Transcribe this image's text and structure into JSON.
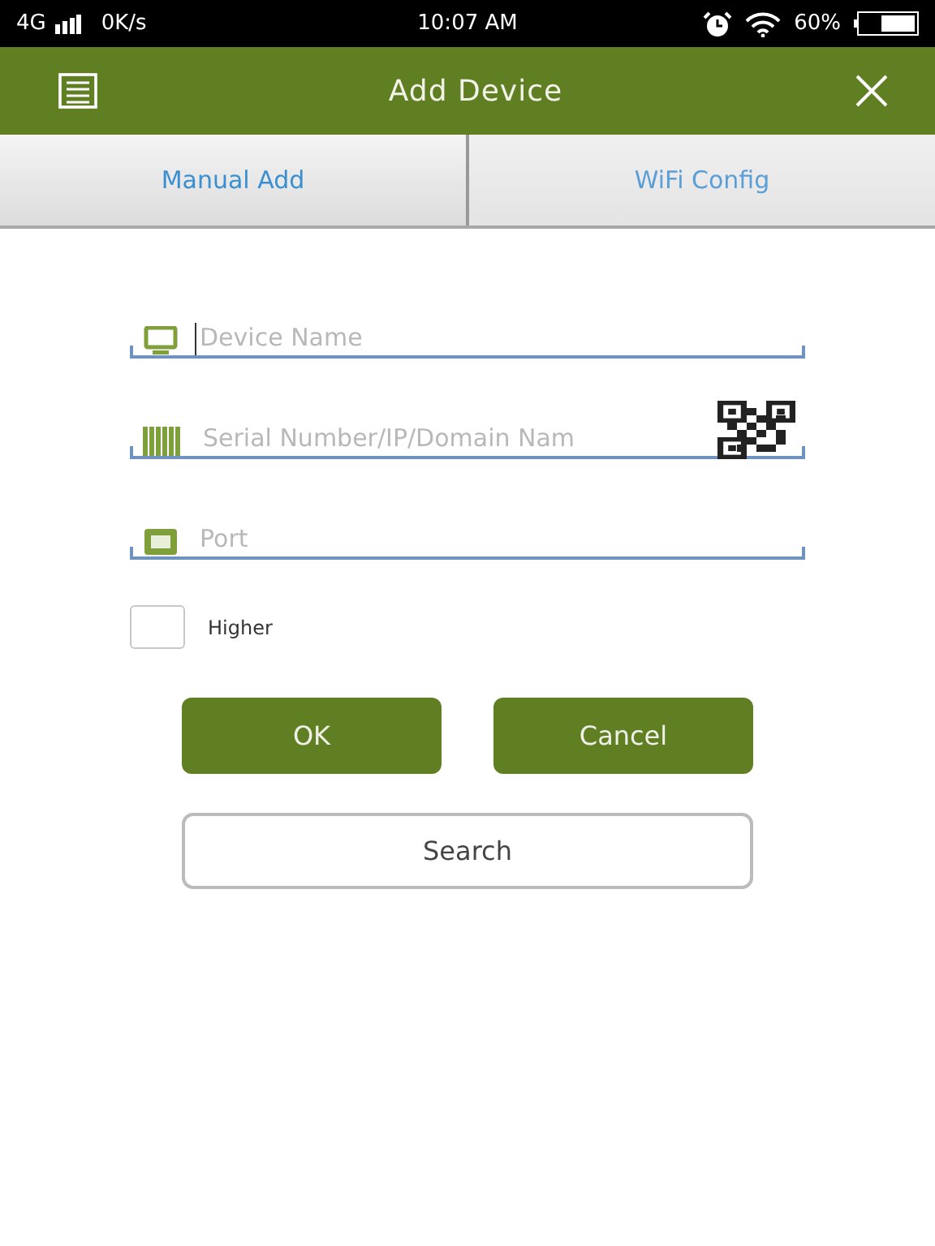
{
  "status_bar": {
    "network": "4G",
    "speed": "0K/s",
    "time": "10:07 AM",
    "battery": "60%"
  },
  "header": {
    "title": "Add Device"
  },
  "tabs": [
    {
      "label": "Manual Add",
      "selected": true
    },
    {
      "label": "WiFi Config",
      "selected": false
    }
  ],
  "fields": [
    {
      "kind": "device",
      "placeholder": "Device Name",
      "focused": true
    },
    {
      "kind": "serial",
      "placeholder": "Serial Number/IP/Domain Nam",
      "focused": false
    },
    {
      "kind": "port",
      "placeholder": "Port",
      "focused": false
    }
  ],
  "higher": {
    "label": "Higher",
    "checked": false
  },
  "buttons": [
    {
      "label": "OK"
    },
    {
      "label": "Cancel"
    }
  ],
  "search_button": {
    "label": "Search"
  }
}
